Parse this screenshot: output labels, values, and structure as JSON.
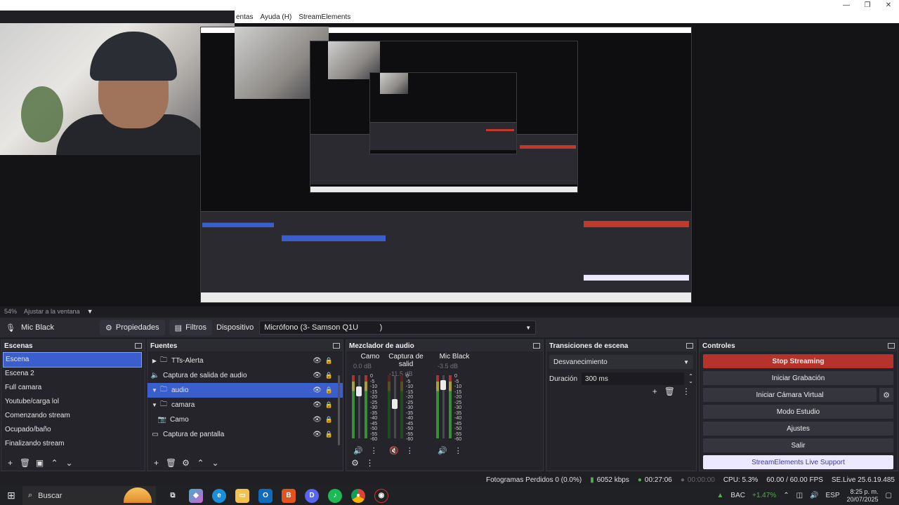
{
  "menu": {
    "items": [
      "entas",
      "Ayuda (H)",
      "StreamElements"
    ]
  },
  "window_controls": [
    "—",
    "❐",
    "✕"
  ],
  "preview": {
    "zoom_label": "54%",
    "fit_label": "Ajustar a la ventana"
  },
  "source_toolbar": {
    "source_name": "Mic Black",
    "properties_label": "Propiedades",
    "filters_label": "Filtros",
    "device_label": "Dispositivo",
    "device_value": "Micrófono (3- Samson Q1U          )"
  },
  "scenes": {
    "title": "Escenas",
    "items": [
      "Escena",
      "Escena 2",
      "Full camara",
      "Youtube/carga lol",
      "Comenzando stream",
      "Ocupado/baño",
      "Finalizando stream"
    ],
    "active_index": 0
  },
  "sources": {
    "title": "Fuentes",
    "items": [
      {
        "label": "TTs-Alerta",
        "icon": "folder-icon",
        "arrow": "▶"
      },
      {
        "label": "Captura de salida de audio",
        "icon": "speaker-icon",
        "arrow": ""
      },
      {
        "label": "audio",
        "icon": "folder-icon",
        "arrow": "▼"
      },
      {
        "label": "camara",
        "icon": "folder-icon",
        "arrow": "▼"
      },
      {
        "label": "Camo",
        "icon": "camera-icon",
        "arrow": ""
      },
      {
        "label": "Captura de pantalla",
        "icon": "monitor-icon",
        "arrow": ""
      }
    ],
    "active_index": 2
  },
  "mixer": {
    "title": "Mezclador de audio",
    "channels": [
      {
        "name": "Camo",
        "db": "0.0 dB",
        "level": 0.75
      },
      {
        "name": "Captura de salid",
        "db": "-11.5 dB",
        "level": 0.55
      },
      {
        "name": "Mic Black",
        "db": "-3.5 dB",
        "level": 0.85
      }
    ],
    "scale": [
      "0",
      "-5",
      "-10",
      "-15",
      "-20",
      "-25",
      "-30",
      "-35",
      "-40",
      "-45",
      "-50",
      "-55",
      "-60"
    ]
  },
  "transitions": {
    "title": "Transiciones de escena",
    "selected": "Desvanecimiento",
    "duration_label": "Duración",
    "duration_value": "300 ms"
  },
  "controls": {
    "title": "Controles",
    "stop_streaming": "Stop Streaming",
    "start_recording": "Iniciar Grabación",
    "virtual_camera": "Iniciar Cámara Virtual",
    "studio_mode": "Modo Estudio",
    "settings": "Ajustes",
    "exit": "Salir",
    "support": "StreamElements Live Support"
  },
  "status": {
    "dropped_frames": "Fotogramas Perdidos 0 (0.0%)",
    "bitrate": "6052 kbps",
    "stream_time": "00:27:06",
    "record_time": "00:00:00",
    "cpu": "CPU: 5.3%",
    "fps": "60.00 / 60.00 FPS",
    "version": "SE.Live 25.6.19.485"
  },
  "taskbar": {
    "search_placeholder": "Buscar",
    "stock": "BAC",
    "stock_change": "+1.47%",
    "language": "ESP",
    "time": "8:25 p. m.",
    "date": "20/07/2025"
  },
  "colors": {
    "accent": "#3a5fcd",
    "stream_red": "#b6332b",
    "background": "#1f1f24"
  }
}
